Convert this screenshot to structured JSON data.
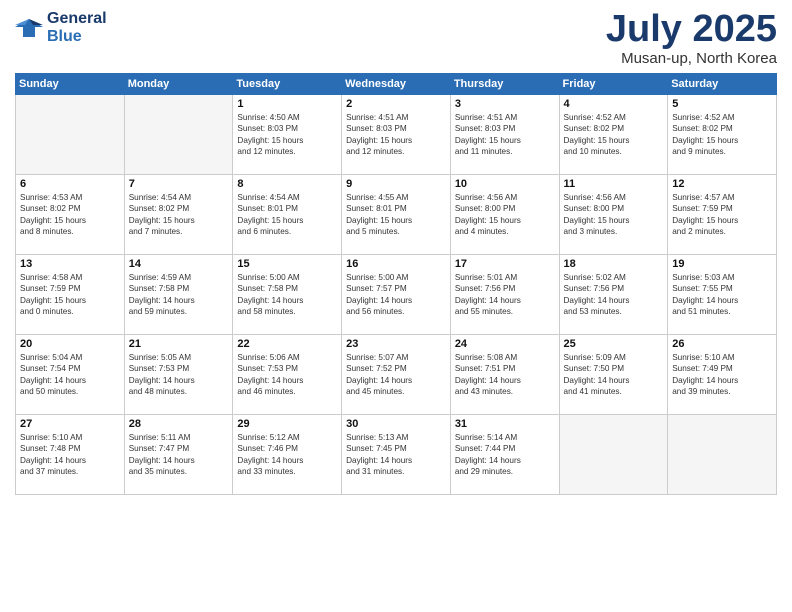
{
  "header": {
    "logo_line1": "General",
    "logo_line2": "Blue",
    "month": "July 2025",
    "location": "Musan-up, North Korea"
  },
  "weekdays": [
    "Sunday",
    "Monday",
    "Tuesday",
    "Wednesday",
    "Thursday",
    "Friday",
    "Saturday"
  ],
  "weeks": [
    [
      {
        "day": "",
        "info": ""
      },
      {
        "day": "",
        "info": ""
      },
      {
        "day": "1",
        "info": "Sunrise: 4:50 AM\nSunset: 8:03 PM\nDaylight: 15 hours\nand 12 minutes."
      },
      {
        "day": "2",
        "info": "Sunrise: 4:51 AM\nSunset: 8:03 PM\nDaylight: 15 hours\nand 12 minutes."
      },
      {
        "day": "3",
        "info": "Sunrise: 4:51 AM\nSunset: 8:03 PM\nDaylight: 15 hours\nand 11 minutes."
      },
      {
        "day": "4",
        "info": "Sunrise: 4:52 AM\nSunset: 8:02 PM\nDaylight: 15 hours\nand 10 minutes."
      },
      {
        "day": "5",
        "info": "Sunrise: 4:52 AM\nSunset: 8:02 PM\nDaylight: 15 hours\nand 9 minutes."
      }
    ],
    [
      {
        "day": "6",
        "info": "Sunrise: 4:53 AM\nSunset: 8:02 PM\nDaylight: 15 hours\nand 8 minutes."
      },
      {
        "day": "7",
        "info": "Sunrise: 4:54 AM\nSunset: 8:02 PM\nDaylight: 15 hours\nand 7 minutes."
      },
      {
        "day": "8",
        "info": "Sunrise: 4:54 AM\nSunset: 8:01 PM\nDaylight: 15 hours\nand 6 minutes."
      },
      {
        "day": "9",
        "info": "Sunrise: 4:55 AM\nSunset: 8:01 PM\nDaylight: 15 hours\nand 5 minutes."
      },
      {
        "day": "10",
        "info": "Sunrise: 4:56 AM\nSunset: 8:00 PM\nDaylight: 15 hours\nand 4 minutes."
      },
      {
        "day": "11",
        "info": "Sunrise: 4:56 AM\nSunset: 8:00 PM\nDaylight: 15 hours\nand 3 minutes."
      },
      {
        "day": "12",
        "info": "Sunrise: 4:57 AM\nSunset: 7:59 PM\nDaylight: 15 hours\nand 2 minutes."
      }
    ],
    [
      {
        "day": "13",
        "info": "Sunrise: 4:58 AM\nSunset: 7:59 PM\nDaylight: 15 hours\nand 0 minutes."
      },
      {
        "day": "14",
        "info": "Sunrise: 4:59 AM\nSunset: 7:58 PM\nDaylight: 14 hours\nand 59 minutes."
      },
      {
        "day": "15",
        "info": "Sunrise: 5:00 AM\nSunset: 7:58 PM\nDaylight: 14 hours\nand 58 minutes."
      },
      {
        "day": "16",
        "info": "Sunrise: 5:00 AM\nSunset: 7:57 PM\nDaylight: 14 hours\nand 56 minutes."
      },
      {
        "day": "17",
        "info": "Sunrise: 5:01 AM\nSunset: 7:56 PM\nDaylight: 14 hours\nand 55 minutes."
      },
      {
        "day": "18",
        "info": "Sunrise: 5:02 AM\nSunset: 7:56 PM\nDaylight: 14 hours\nand 53 minutes."
      },
      {
        "day": "19",
        "info": "Sunrise: 5:03 AM\nSunset: 7:55 PM\nDaylight: 14 hours\nand 51 minutes."
      }
    ],
    [
      {
        "day": "20",
        "info": "Sunrise: 5:04 AM\nSunset: 7:54 PM\nDaylight: 14 hours\nand 50 minutes."
      },
      {
        "day": "21",
        "info": "Sunrise: 5:05 AM\nSunset: 7:53 PM\nDaylight: 14 hours\nand 48 minutes."
      },
      {
        "day": "22",
        "info": "Sunrise: 5:06 AM\nSunset: 7:53 PM\nDaylight: 14 hours\nand 46 minutes."
      },
      {
        "day": "23",
        "info": "Sunrise: 5:07 AM\nSunset: 7:52 PM\nDaylight: 14 hours\nand 45 minutes."
      },
      {
        "day": "24",
        "info": "Sunrise: 5:08 AM\nSunset: 7:51 PM\nDaylight: 14 hours\nand 43 minutes."
      },
      {
        "day": "25",
        "info": "Sunrise: 5:09 AM\nSunset: 7:50 PM\nDaylight: 14 hours\nand 41 minutes."
      },
      {
        "day": "26",
        "info": "Sunrise: 5:10 AM\nSunset: 7:49 PM\nDaylight: 14 hours\nand 39 minutes."
      }
    ],
    [
      {
        "day": "27",
        "info": "Sunrise: 5:10 AM\nSunset: 7:48 PM\nDaylight: 14 hours\nand 37 minutes."
      },
      {
        "day": "28",
        "info": "Sunrise: 5:11 AM\nSunset: 7:47 PM\nDaylight: 14 hours\nand 35 minutes."
      },
      {
        "day": "29",
        "info": "Sunrise: 5:12 AM\nSunset: 7:46 PM\nDaylight: 14 hours\nand 33 minutes."
      },
      {
        "day": "30",
        "info": "Sunrise: 5:13 AM\nSunset: 7:45 PM\nDaylight: 14 hours\nand 31 minutes."
      },
      {
        "day": "31",
        "info": "Sunrise: 5:14 AM\nSunset: 7:44 PM\nDaylight: 14 hours\nand 29 minutes."
      },
      {
        "day": "",
        "info": ""
      },
      {
        "day": "",
        "info": ""
      }
    ]
  ]
}
